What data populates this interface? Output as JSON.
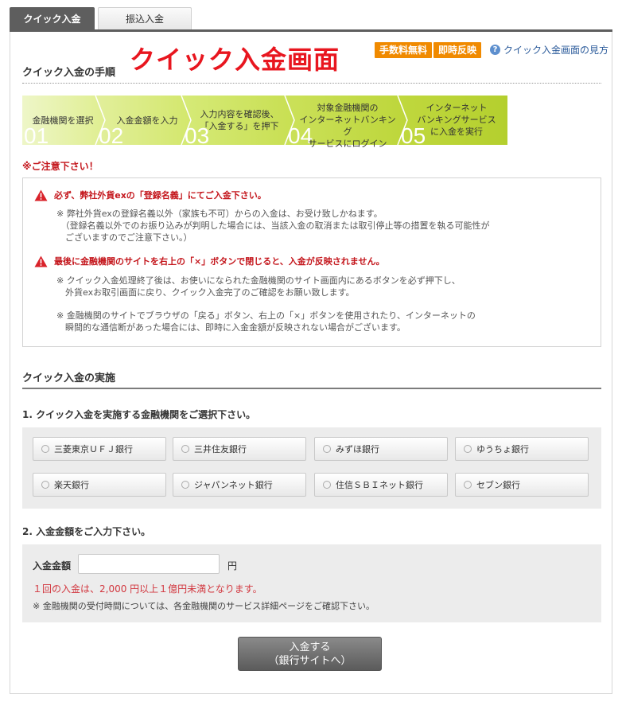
{
  "tabs": {
    "active": "クイック入金",
    "inactive": "振込入金"
  },
  "header": {
    "section_title": "クイック入金の手順",
    "big_title": "クイック入金画面",
    "badge_fee": "手数料無料",
    "badge_instant": "即時反映",
    "help_link": "クイック入金画面の見方",
    "help_icon": "question-circle-icon"
  },
  "steps": [
    {
      "label": "金融機関を選択",
      "num": "01"
    },
    {
      "label": "入金金額を入力",
      "num": "02"
    },
    {
      "label": "入力内容を確認後、\n「入金する」を押下",
      "num": "03"
    },
    {
      "label": "対象金融機関の\nインターネットバンキング\nサービスにログイン",
      "num": "04"
    },
    {
      "label": "インターネット\nバンキングサービス\nに入金を実行",
      "num": "05"
    }
  ],
  "caution": {
    "title": "※ご注意下さい！",
    "warning1": "必ず、弊社外貨exの「登録名義」にてご入金下さい。",
    "note1": "※ 弊社外貨exの登録名義以外（家族も不可）からの入金は、お受け致しかねます。\n　（登録名義以外でのお振り込みが判明した場合には、当該入金の取消または取引停止等の措置を執る可能性が\n　ございますのでご注意下さい。）",
    "warning2": "最後に金融機関のサイトを右上の「×」ボタンで閉じると、入金が反映されません。",
    "note2": "※ クイック入金処理終了後は、お使いになられた金融機関のサイト画面内にあるボタンを必ず押下し、\n　外貨exお取引画面に戻り、クイック入金完了のご確認をお願い致します。",
    "note3": "※ 金融機関のサイトでブラウザの「戻る」ボタン、右上の「×」ボタンを使用されたり、インターネットの\n　瞬間的な通信断があった場合には、即時に入金金額が反映されない場合がございます。",
    "warning_icon": "warning-triangle-icon"
  },
  "execution": {
    "title": "クイック入金の実施",
    "step1_title": "1. クイック入金を実施する金融機関をご選択下さい。",
    "banks": [
      "三菱東京ＵＦＪ銀行",
      "三井住友銀行",
      "みずほ銀行",
      "ゆうちょ銀行",
      "楽天銀行",
      "ジャパンネット銀行",
      "住信ＳＢＩネット銀行",
      "セブン銀行"
    ],
    "step2_title": "2. 入金金額をご入力下さい。",
    "amount_label": "入金金額",
    "amount_value": "",
    "unit": "円",
    "amount_note_red": "１回の入金は、2,000 円以上１億円未満となります。",
    "amount_note": "※ 金融機関の受付時間については、各金融機関のサービス詳細ページをご確認下さい。",
    "submit_line1": "入金する",
    "submit_line2": "（銀行サイトへ）"
  },
  "colors": {
    "accent_red": "#e8161f",
    "badge_orange": "#f08a00",
    "step_green_light": "#eaf3b4",
    "step_green_dark": "#c3d83a",
    "tab_dark": "#5e5e5e"
  }
}
